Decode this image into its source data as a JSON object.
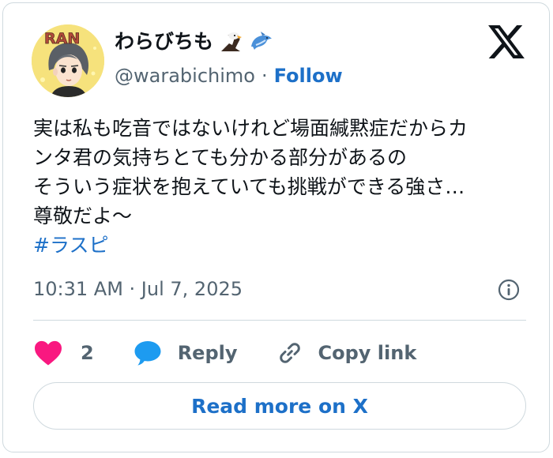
{
  "author": {
    "display_name": "わらびちも",
    "handle": "@warabichimo",
    "follow_label": "Follow",
    "avatar_text": "RAN",
    "name_emojis": [
      "eagle-emoji",
      "dolphin-emoji"
    ]
  },
  "tweet": {
    "lines": [
      "実は私も吃音ではないけれど場面緘黙症だからカ",
      "ンタ君の気持ちとても分かる部分があるの",
      "そういう症状を抱えていても挑戦ができる強さ…",
      "尊敬だよ〜"
    ],
    "hashtag": "#ラスピ",
    "timestamp": "10:31 AM · Jul 7, 2025"
  },
  "actions": {
    "like_count": "2",
    "reply_label": "Reply",
    "copy_label": "Copy link"
  },
  "read_more_label": "Read more on X",
  "colors": {
    "accent": "#1d70c8",
    "like": "#f91880",
    "reply_icon": "#1d9bf0",
    "muted": "#536471",
    "border": "#cfd9de"
  },
  "icons": {
    "platform": "x-logo-icon",
    "info": "info-icon",
    "like": "heart-icon",
    "reply": "speech-bubble-icon",
    "copy": "link-icon"
  }
}
